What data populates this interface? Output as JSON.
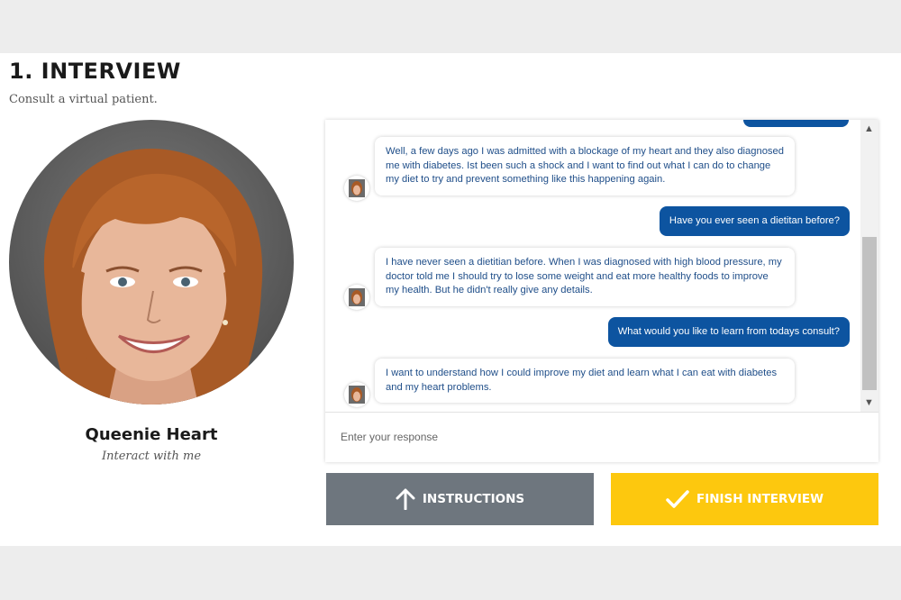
{
  "header": {
    "title": "1. INTERVIEW",
    "subtitle": "Consult a virtual patient."
  },
  "patient": {
    "name": "Queenie Heart",
    "subtitle": "Interact with me"
  },
  "chat": {
    "messages": [
      {
        "from": "patient",
        "text": "Well, a few days ago I was admitted with a blockage of my heart and they also diagnosed me with diabetes. Ist been such a shock and I want to find out what I can do to change my diet to try and prevent something like this happening again."
      },
      {
        "from": "user",
        "text": "Have you ever seen a dietitan before?"
      },
      {
        "from": "patient",
        "text": "I have never seen a dietitian before. When I was diagnosed with high blood pressure, my doctor told me I should try to lose some weight and eat more healthy foods to improve my health. But he didn't really give any details."
      },
      {
        "from": "user",
        "text": "What would you like to learn from todays consult?"
      },
      {
        "from": "patient",
        "text": "I want to understand how I could improve my diet and learn what I can eat with diabetes and my heart problems."
      }
    ],
    "input_placeholder": "Enter your response"
  },
  "buttons": {
    "instructions": "INSTRUCTIONS",
    "finish": "FINISH INTERVIEW"
  },
  "colors": {
    "user_bubble": "#0d54a0",
    "patient_text": "#1f4e89",
    "instructions_button": "#6e767e",
    "finish_button": "#fdc80e"
  }
}
